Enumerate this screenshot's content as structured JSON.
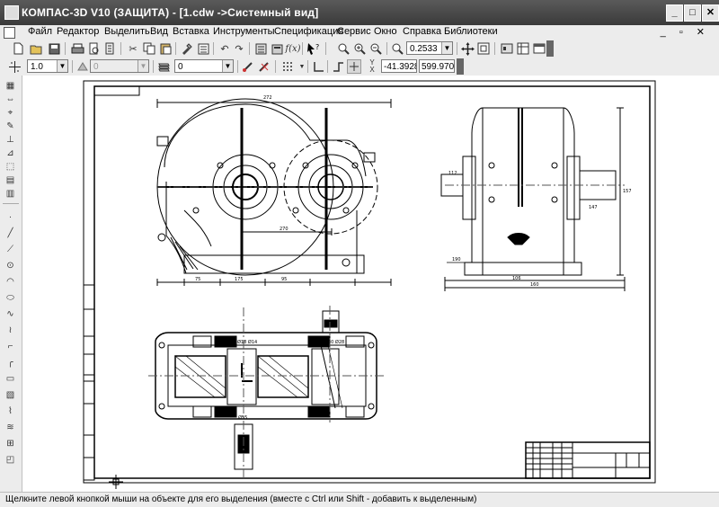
{
  "window": {
    "title": "КОМПАС-3D V10 (ЗАЩИТА) - [1.cdw ->Системный вид]",
    "minimize_label": "_",
    "maximize_label": "□",
    "close_label": "✕"
  },
  "menu": {
    "items": [
      "Файл",
      "Редактор",
      "Выделить",
      "Вид",
      "Вставка",
      "Инструменты",
      "Спецификация",
      "Сервис",
      "Окно",
      "Справка",
      "Библиотеки"
    ],
    "mdi_controls": "_ ▫ ✕"
  },
  "toolbar_standard": {
    "zoom_value": "0.2533"
  },
  "toolbar_current_state": {
    "step_value": "1.0",
    "layer_value": "0",
    "style_value": "0",
    "x_coord": "-41.3928",
    "y_coord": "599.970"
  },
  "status_bar": {
    "message": "Щелкните левой кнопкой мыши на объекте для его выделения (вместе с Ctrl или Shift - добавить к выделенным)"
  },
  "drawing": {
    "file_name": "1.cdw",
    "dimensions": [
      "272",
      "270",
      "75",
      "175",
      "95",
      "106",
      "160",
      "157",
      "147",
      "112",
      "190",
      "Ø18 Ø14",
      "Ø55",
      "Ø30 Ø28"
    ]
  }
}
